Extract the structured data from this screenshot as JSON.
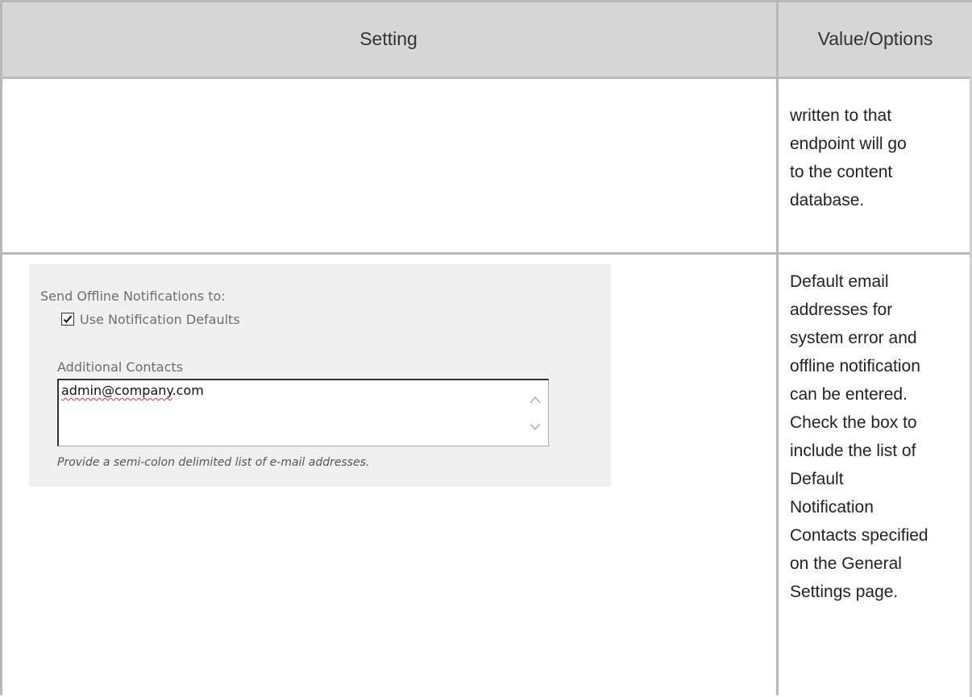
{
  "table": {
    "headers": {
      "setting": "Setting",
      "value_options": "Value/Options"
    },
    "rows": [
      {
        "value_lines": [
          "written to that",
          "endpoint will go",
          "to the content",
          "database."
        ]
      },
      {
        "panel": {
          "section_label": "Send Offline Notifications to:",
          "checkbox_label": "Use Notification Defaults",
          "checkbox_checked": true,
          "contacts_label": "Additional Contacts",
          "contacts_value_misspelled": "admin@company",
          "contacts_value_rest": ".com",
          "hint": "Provide a semi-colon delimited list of e-mail addresses."
        },
        "value_lines": [
          "Default email",
          "addresses for",
          "system error and",
          "offline notification",
          "can be entered.",
          "Check the box to",
          "include the list of",
          "Default",
          "Notification",
          "Contacts specified",
          "on the General",
          "Settings page."
        ]
      }
    ]
  },
  "icons": {
    "checkbox": "checkmark-icon",
    "scroll_up": "chevron-up-icon",
    "scroll_down": "chevron-down-icon"
  },
  "colors": {
    "header_bg": "#d6d6d6",
    "panel_bg": "#f0f0f0",
    "border": "#b9b9b9",
    "spellcheck": "#dd3333"
  }
}
